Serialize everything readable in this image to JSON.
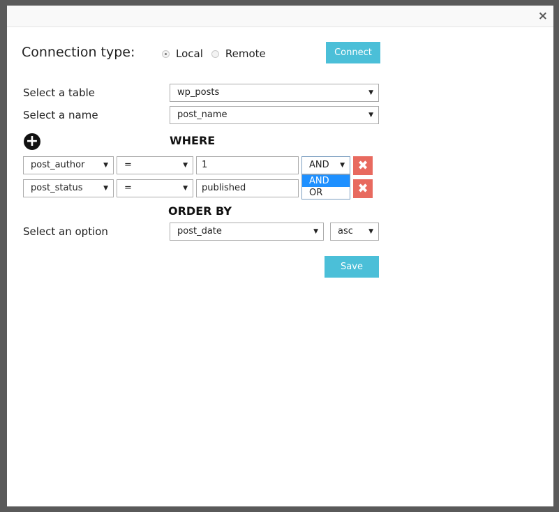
{
  "dialog": {
    "close_label": "×"
  },
  "connection": {
    "label": "Connection type:",
    "options": [
      "Local",
      "Remote"
    ],
    "selected": "Local",
    "connect_label": "Connect"
  },
  "table": {
    "label": "Select a table",
    "value": "wp_posts"
  },
  "name": {
    "label": "Select a name",
    "value": "post_name"
  },
  "where": {
    "heading": "WHERE",
    "rows": [
      {
        "field": "post_author",
        "operator": "=",
        "value": "1",
        "conjunction": "AND"
      },
      {
        "field": "post_status",
        "operator": "=",
        "value": "published"
      }
    ],
    "conjunction_options": [
      "AND",
      "OR"
    ],
    "conjunction_highlighted": "AND"
  },
  "order": {
    "heading": "ORDER BY",
    "label": "Select an option",
    "field": "post_date",
    "direction": "asc"
  },
  "save_label": "Save",
  "colors": {
    "primary": "#4bbfd8",
    "danger": "#e86a5f",
    "highlight": "#1e90ff"
  }
}
